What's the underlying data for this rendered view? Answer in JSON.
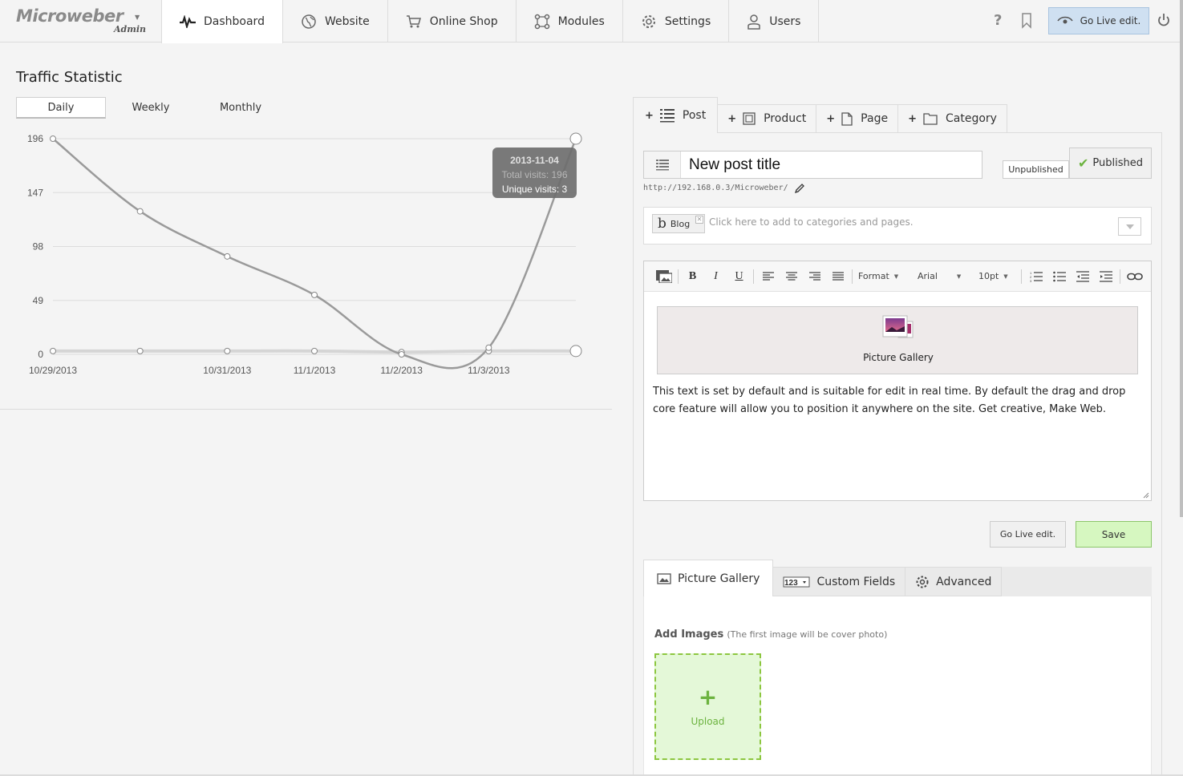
{
  "header": {
    "brand": "Microweber",
    "brand_sub": "Admin",
    "nav": [
      {
        "label": "Dashboard",
        "icon": "pulse-icon"
      },
      {
        "label": "Website",
        "icon": "globe-icon"
      },
      {
        "label": "Online Shop",
        "icon": "cart-icon"
      },
      {
        "label": "Modules",
        "icon": "modules-icon"
      },
      {
        "label": "Settings",
        "icon": "gear-icon"
      },
      {
        "label": "Users",
        "icon": "user-icon"
      }
    ],
    "help": "?",
    "go_live_label": "Go Live edit."
  },
  "stats": {
    "title": "Traffic Statistic",
    "tabs": [
      "Daily",
      "Weekly",
      "Monthly"
    ],
    "active_tab": "Daily",
    "tooltip": {
      "date": "2013-11-04",
      "total": "Total visits: 196",
      "unique": "Unique visits: 3"
    }
  },
  "chart_data": {
    "type": "line",
    "x": [
      "10/29/2013",
      "10/30/2013",
      "10/31/2013",
      "11/1/2013",
      "11/2/2013",
      "11/3/2013",
      "11/4/2013"
    ],
    "x_tick_labels": [
      "10/29/2013",
      "",
      "10/31/2013",
      "11/1/2013",
      "11/2/2013",
      "11/3/2013",
      ""
    ],
    "y_ticks": [
      0,
      49,
      98,
      147,
      196
    ],
    "ylim": [
      0,
      196
    ],
    "series": [
      {
        "name": "Total visits",
        "values": [
          196,
          130,
          89,
          54,
          0,
          6,
          196
        ],
        "color": "#9a9a9a"
      },
      {
        "name": "Unique visits",
        "values": [
          3,
          3,
          3,
          3,
          2,
          3,
          3
        ],
        "color": "#d5d5d5"
      }
    ],
    "grid": true
  },
  "content": {
    "type_tabs": [
      {
        "label": "Post",
        "icon": "post-icon"
      },
      {
        "label": "Product",
        "icon": "product-icon"
      },
      {
        "label": "Page",
        "icon": "page-icon"
      },
      {
        "label": "Category",
        "icon": "folder-icon"
      }
    ],
    "plus": "+",
    "title_value": "New post title",
    "status_unpublished": "Unpublished",
    "status_published": "Published",
    "url": "http://192.168.0.3/Microweber/",
    "category_chip": "Blog",
    "category_chip_letter": "b",
    "category_placeholder": "Click here to add to categories and pages.",
    "toolbar": {
      "bold": "B",
      "italic": "I",
      "underline": "U",
      "format": "Format",
      "font": "Arial",
      "size": "10pt"
    },
    "gallery_label": "Picture Gallery",
    "body_text": "This text is set by default and is suitable for edit in real time. By default the drag and drop core feature will allow you to position it anywhere on the site. Get creative, Make Web.",
    "go_live_label": "Go Live edit.",
    "save_label": "Save",
    "bottom_tabs": [
      {
        "label": "Picture Gallery",
        "icon": "image-icon"
      },
      {
        "label": "Custom Fields",
        "icon": "custom-fields-icon"
      },
      {
        "label": "Advanced",
        "icon": "gear-icon"
      }
    ],
    "custom_fields_icon_text": "123",
    "add_images_label": "Add Images",
    "add_images_hint": "(The first image will be cover photo)",
    "upload_plus": "+",
    "upload_label": "Upload"
  }
}
